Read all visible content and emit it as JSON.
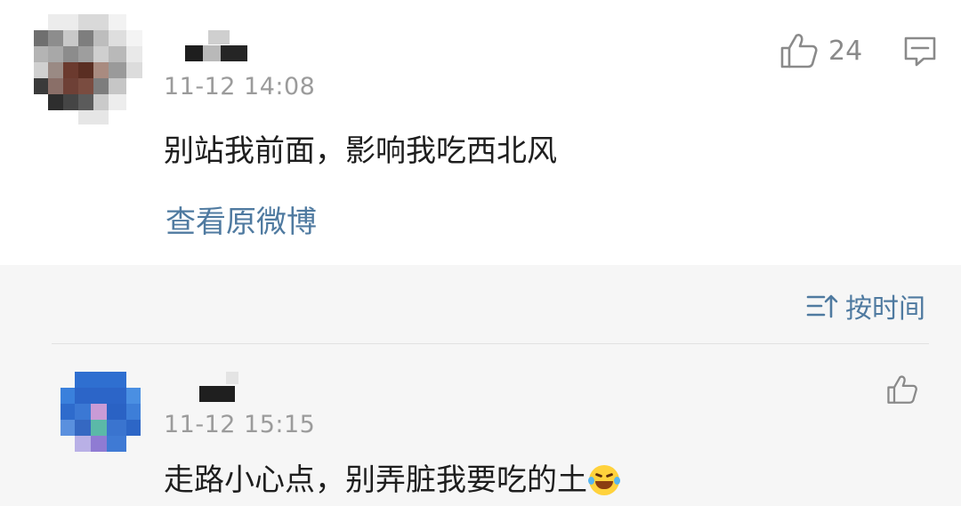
{
  "post": {
    "time": "11-12 14:08",
    "text": "别站我前面，影响我吃西北风",
    "view_original": "查看原微博",
    "like_count": "24",
    "like_icon": "thumbs-up-icon",
    "comment_icon": "comment-icon"
  },
  "sort": {
    "label": "按时间",
    "icon": "sort-icon",
    "color": "#4f7aa0"
  },
  "replies": [
    {
      "time": "11-12 15:15",
      "text": "走路小心点，别弄脏我要吃的土",
      "emoji": "laughing-crying-emoji",
      "like_icon": "thumbs-up-icon"
    }
  ]
}
